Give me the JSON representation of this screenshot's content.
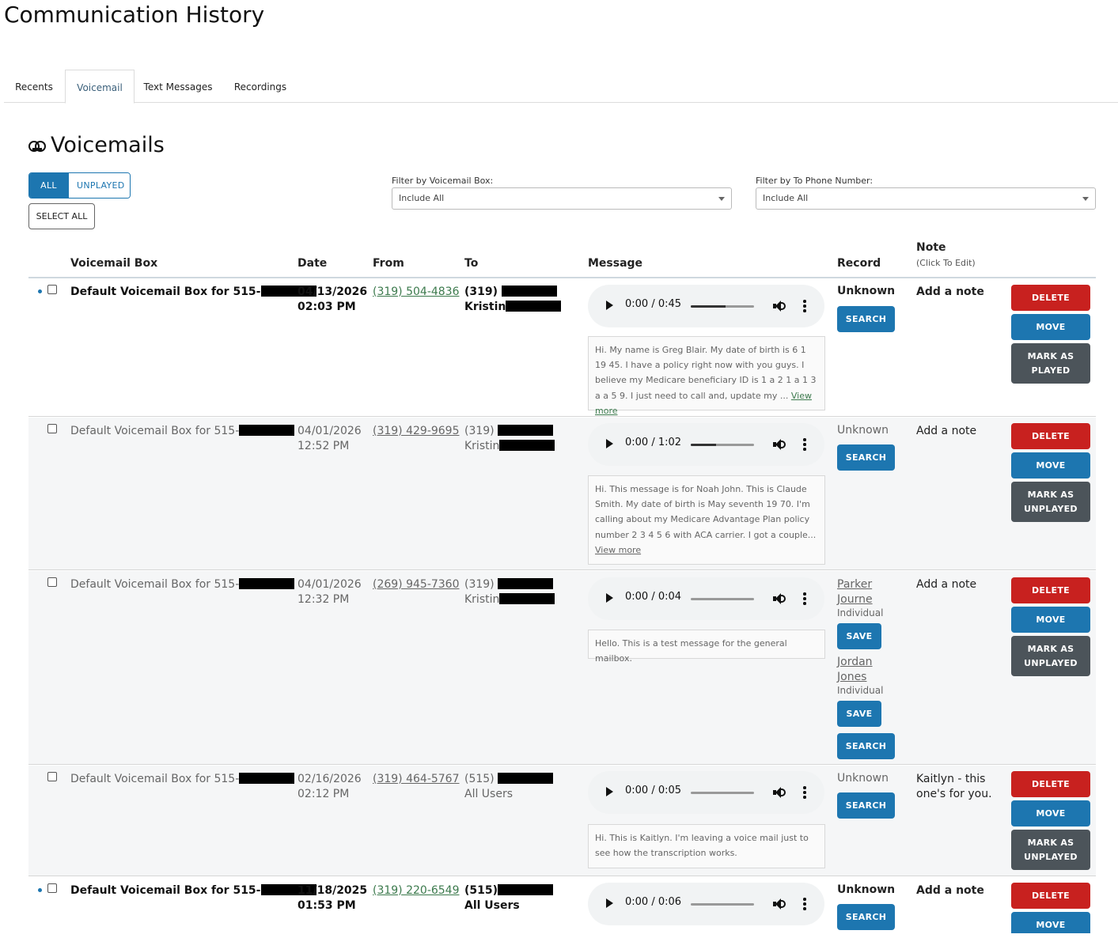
{
  "page_title": "Communication History",
  "tabs": [
    {
      "label": "Recents"
    },
    {
      "label": "Voicemail"
    },
    {
      "label": "Text Messages"
    },
    {
      "label": "Recordings"
    }
  ],
  "section_title": "Voicemails",
  "filters": {
    "all_label": "ALL",
    "unplayed_label": "UNPLAYED",
    "select_all_label": "SELECT ALL",
    "voicemail_box_label": "Filter by Voicemail Box:",
    "voicemail_box_value": "Include All",
    "phone_label": "Filter by To Phone Number:",
    "phone_value": "Include All"
  },
  "columns": {
    "voicemail_box": "Voicemail Box",
    "date": "Date",
    "from": "From",
    "to": "To",
    "message": "Message",
    "record": "Record",
    "note": "Note",
    "note_sub": "(Click To Edit)"
  },
  "actions": {
    "delete": "DELETE",
    "move": "MOVE",
    "search": "SEARCH",
    "save": "SAVE",
    "mark_played_1": "MARK AS",
    "mark_played_2": "PLAYED",
    "mark_unplayed_1": "MARK AS",
    "mark_unplayed_2": "UNPLAYED",
    "view_more": "View more"
  },
  "voicemails": [
    {
      "box": "Default Voicemail Box for 515-",
      "date": "04/13/2026",
      "time": "02:03 PM",
      "from": "(319) 504-4836",
      "to_line1": "(319)",
      "to_line2": "Kristin",
      "player_time": "0:00 / 0:45",
      "progress": 0.55,
      "transcript": "Hi. My name is Greg Blair. My date of birth is 6 1 19 45. I have a policy right now with you guys. I believe my Medicare beneficiary ID is 1 a 2 1 a 1 3 a a 5 9. I just need to call and, update my ...",
      "record": "Unknown",
      "note": "Add a note"
    },
    {
      "box": "Default Voicemail Box for 515-",
      "date": "04/01/2026",
      "time": "12:52 PM",
      "from": "(319) 429-9695",
      "to_line1": "(319)",
      "to_line2": "Kristin",
      "player_time": "0:00 / 1:02",
      "progress": 0.4,
      "transcript": "Hi. This message is for Noah John. This is Claude Smith. My date of birth is May seventh 19 70. I'm calling about my Medicare Advantage Plan policy number 2 3 4 5 6 with ACA carrier. I got a couple...",
      "record": "Unknown",
      "note": "Add a note"
    },
    {
      "box": "Default Voicemail Box for 515-",
      "date": "04/01/2026",
      "time": "12:32 PM",
      "from": "(269) 945-7360",
      "to_line1": "(319)",
      "to_line2": "Kristin",
      "player_time": "0:00 / 0:04",
      "progress": 0,
      "transcript": "Hello. This is a test message for the general mailbox.",
      "record_matches": [
        {
          "first": "Parker",
          "last": "Journe",
          "type": "Individual"
        },
        {
          "first": "Jordan",
          "last": "Jones",
          "type": "Individual"
        }
      ],
      "note": "Add a note"
    },
    {
      "box": "Default Voicemail Box for 515-",
      "date": "02/16/2026",
      "time": "02:12 PM",
      "from": "(319) 464-5767",
      "to_line1": "(515)",
      "to_line2": "All Users",
      "player_time": "0:00 / 0:05",
      "progress": 0,
      "transcript": "Hi. This is Kaitlyn. I'm leaving a voice mail just to see how the transcription works.",
      "record": "Unknown",
      "note_line1": "Kaitlyn - this",
      "note_line2": "one's for you."
    },
    {
      "box": "Default Voicemail Box for 515-",
      "date": "11/18/2025",
      "time": "01:53 PM",
      "from": "(319) 220-6549",
      "to_line1": "(515)",
      "to_line2": "All Users",
      "player_time": "0:00 / 0:06",
      "progress": 0,
      "record": "Unknown",
      "note": "Add a note"
    }
  ]
}
